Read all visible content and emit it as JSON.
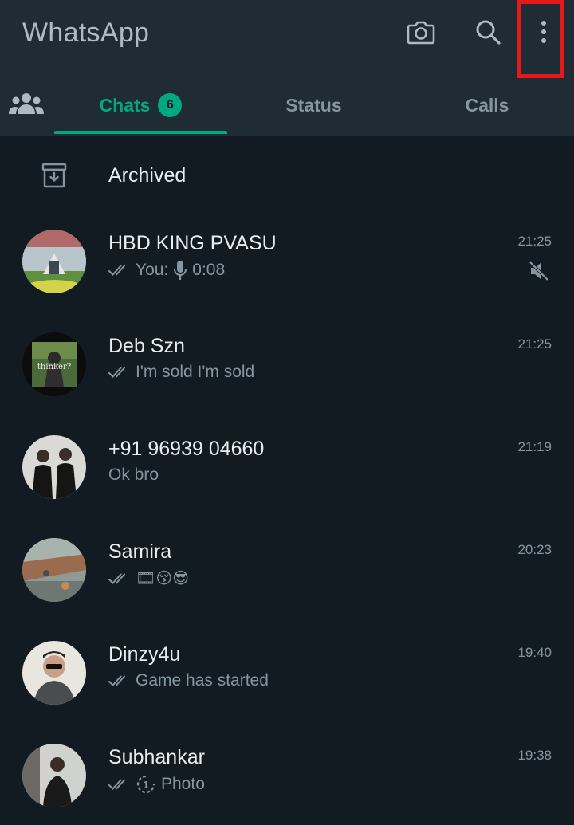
{
  "header": {
    "title": "WhatsApp",
    "icons": [
      "camera-icon",
      "search-icon",
      "more-vertical-icon"
    ],
    "highlight_color": "#e5191b"
  },
  "tabs": {
    "community_icon": "community-icon",
    "items": [
      {
        "label": "Chats",
        "badge": "6",
        "active": true
      },
      {
        "label": "Status",
        "badge": null,
        "active": false
      },
      {
        "label": "Calls",
        "badge": null,
        "active": false
      }
    ],
    "accent": "#00a884"
  },
  "archived": {
    "label": "Archived",
    "icon": "archive-icon"
  },
  "chats": [
    {
      "name": "HBD KING PVASU",
      "preview_prefix": "You:",
      "preview": "0:08",
      "time": "21:25",
      "ticks": true,
      "voice": true,
      "muted": true
    },
    {
      "name": "Deb Szn",
      "preview": "I'm sold I'm sold",
      "time": "21:25",
      "ticks": true,
      "avatar_text": "thinker?"
    },
    {
      "name": "+91 96939 04660",
      "preview": "Ok bro",
      "time": "21:19",
      "ticks": false
    },
    {
      "name": "Samira",
      "preview": "🎞😚😎",
      "time": "20:23",
      "ticks": true
    },
    {
      "name": "Dinzy4u",
      "preview": "Game has started",
      "time": "19:40",
      "ticks": true
    },
    {
      "name": "Subhankar",
      "preview": "Photo",
      "time": "19:38",
      "ticks": true,
      "view_once": "1"
    }
  ]
}
